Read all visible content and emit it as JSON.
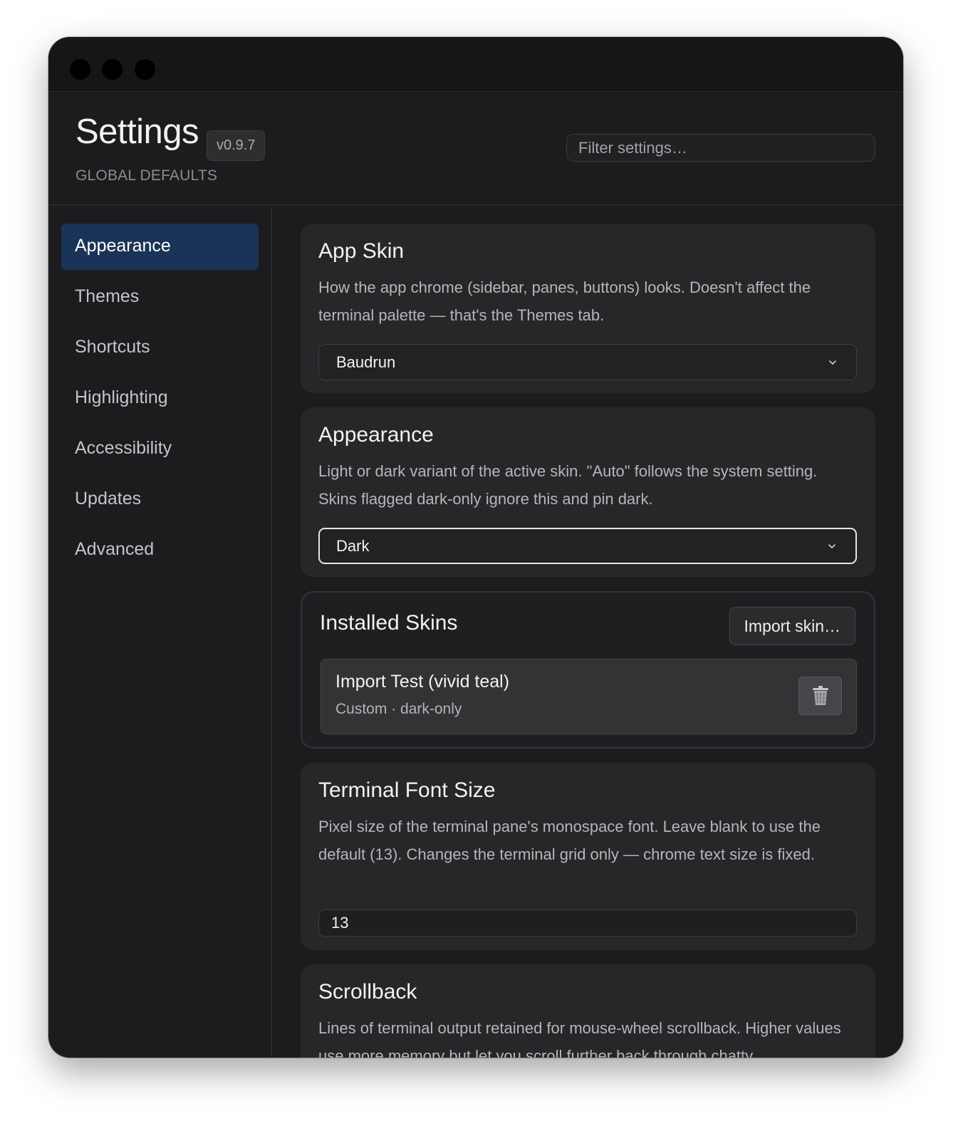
{
  "header": {
    "title": "Settings",
    "version": "v0.9.7",
    "subtitle": "GLOBAL DEFAULTS",
    "filter_placeholder": "Filter settings…"
  },
  "sidebar": {
    "items": [
      {
        "label": "Appearance",
        "active": true
      },
      {
        "label": "Themes"
      },
      {
        "label": "Shortcuts"
      },
      {
        "label": "Highlighting"
      },
      {
        "label": "Accessibility"
      },
      {
        "label": "Updates"
      },
      {
        "label": "Advanced"
      }
    ]
  },
  "sections": {
    "app_skin": {
      "title": "App Skin",
      "description": "How the app chrome (sidebar, panes, buttons) looks. Doesn't affect the terminal palette — that's the Themes tab.",
      "selected": "Baudrun"
    },
    "appearance": {
      "title": "Appearance",
      "description": "Light or dark variant of the active skin. \"Auto\" follows the system setting. Skins flagged dark-only ignore this and pin dark.",
      "selected": "Dark"
    },
    "installed_skins": {
      "title": "Installed Skins",
      "import_label": "Import skin…",
      "items": [
        {
          "name": "Import Test (vivid teal)",
          "meta": "Custom · dark-only",
          "delete_icon": "trash-icon"
        }
      ]
    },
    "terminal_font_size": {
      "title": "Terminal Font Size",
      "description": "Pixel size of the terminal pane's monospace font. Leave blank to use the default (13). Changes the terminal grid only — chrome text size is fixed.",
      "value": "13"
    },
    "scrollback": {
      "title": "Scrollback",
      "description": "Lines of terminal output retained for mouse-wheel scrollback. Higher values use more memory but let you scroll further back through chatty"
    }
  },
  "colors": {
    "window_bg": "#1c1c1f",
    "titlebar_bg": "#161617",
    "card_bg": "#27272a",
    "active_nav": "#1a3457",
    "text_primary": "#f2f2f2",
    "text_secondary": "#b6b6ba"
  }
}
